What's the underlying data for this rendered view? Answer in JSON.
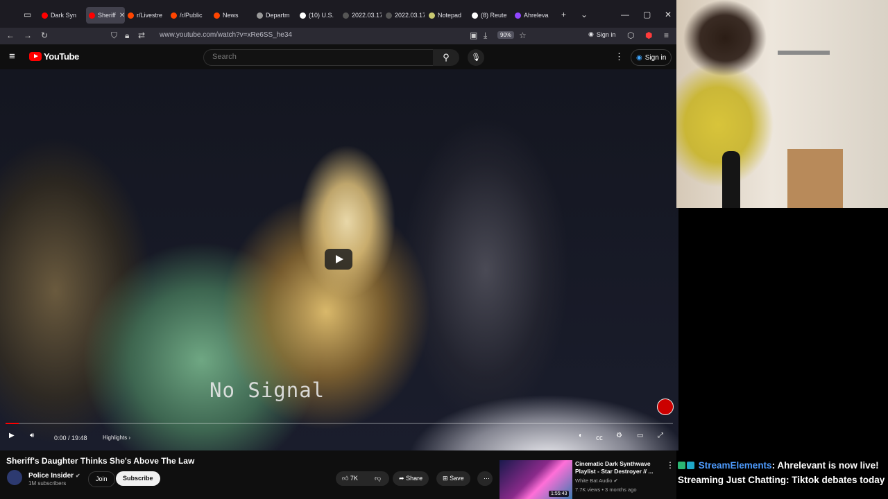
{
  "browser": {
    "tabs": [
      {
        "label": "Dark Syn",
        "color": "#ff0000"
      },
      {
        "label": "Sheriff",
        "color": "#ff0000",
        "active": true
      },
      {
        "label": "r/Livestre",
        "color": "#ff4500"
      },
      {
        "label": "/r/Public",
        "color": "#ff4500"
      },
      {
        "label": "News",
        "color": "#ff4500"
      },
      {
        "label": "Departm",
        "color": "#999999"
      },
      {
        "label": "(10) U.S.",
        "color": "#ffffff"
      },
      {
        "label": "2022.03.17-",
        "color": "#555555"
      },
      {
        "label": "2022.03.17-",
        "color": "#555555"
      },
      {
        "label": "Notepad",
        "color": "#c8c870"
      },
      {
        "label": "(8) Reute",
        "color": "#ffffff"
      },
      {
        "label": "Ahreleva",
        "color": "#9146ff"
      }
    ],
    "url": "www.youtube.com/watch?v=xRe6SS_he34",
    "zoom": "90%",
    "sign_in": "Sign in"
  },
  "youtube": {
    "logo": "YouTube",
    "search_placeholder": "Search",
    "sign_in": "Sign in"
  },
  "video": {
    "overlay_text": "No Signal",
    "time": "0:00 / 19:48",
    "highlights": "Highlights",
    "progress": 0.02
  },
  "watch": {
    "title": "Sheriff's Daughter Thinks She's Above The Law",
    "channel": "Police Insider",
    "subscribers": "1M subscribers",
    "join": "Join",
    "subscribe": "Subscribe",
    "likes": "7K",
    "share": "Share",
    "save": "Save"
  },
  "related": {
    "title": "Cinematic Dark Synthwave Playlist - Star Destroyer // ...",
    "channel": "White Bat Audio",
    "meta": "7.7K views • 3 months ago",
    "duration": "1:55:43"
  },
  "chat": {
    "user": "StreamElements",
    "message": ": Ahrelevant is now live! Streaming Just Chatting: Tiktok debates today"
  },
  "colors": {
    "accent": "#ff0000",
    "link": "#3ea6ff",
    "chat_user": "#4e9cff"
  }
}
